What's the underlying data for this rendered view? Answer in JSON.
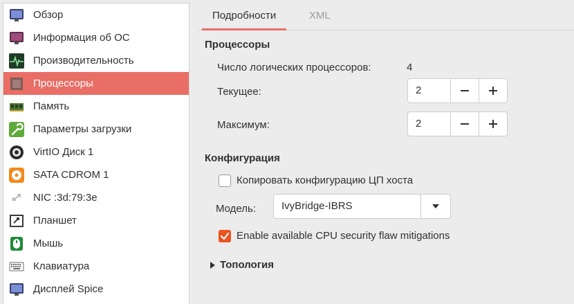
{
  "sidebar": {
    "items": [
      {
        "label": "Обзор",
        "icon": "monitor-icon"
      },
      {
        "label": "Информация об ОС",
        "icon": "os-info-icon"
      },
      {
        "label": "Производительность",
        "icon": "performance-graph-icon"
      },
      {
        "label": "Процессоры",
        "icon": "cpu-chip-icon"
      },
      {
        "label": "Память",
        "icon": "memory-module-icon"
      },
      {
        "label": "Параметры загрузки",
        "icon": "wrench-icon"
      },
      {
        "label": "VirtIO Диск 1",
        "icon": "disk-icon"
      },
      {
        "label": "SATA CDROM 1",
        "icon": "cdrom-icon"
      },
      {
        "label": "NIC :3d:79:3e",
        "icon": "network-icon"
      },
      {
        "label": "Планшет",
        "icon": "tablet-icon"
      },
      {
        "label": "Мышь",
        "icon": "mouse-icon"
      },
      {
        "label": "Клавиатура",
        "icon": "keyboard-icon"
      },
      {
        "label": "Дисплей Spice",
        "icon": "display-icon"
      }
    ],
    "selected_index": 3
  },
  "tabs": {
    "details": "Подробности",
    "xml": "XML"
  },
  "processors": {
    "heading": "Процессоры",
    "logical_label": "Число логических процессоров:",
    "logical_value": "4",
    "current_label": "Текущее:",
    "current_value": "2",
    "max_label": "Максимум:",
    "max_value": "2"
  },
  "config": {
    "heading": "Конфигурация",
    "copy_host_label": "Копировать конфигурацию ЦП хоста",
    "copy_host_checked": false,
    "model_label": "Модель:",
    "model_value": "IvyBridge-IBRS",
    "mitigations_label": "Enable available CPU security flaw mitigations",
    "mitigations_checked": true
  },
  "topology": {
    "label": "Топология"
  },
  "colors": {
    "accent": "#e96e65",
    "checkbox": "#e95420"
  }
}
